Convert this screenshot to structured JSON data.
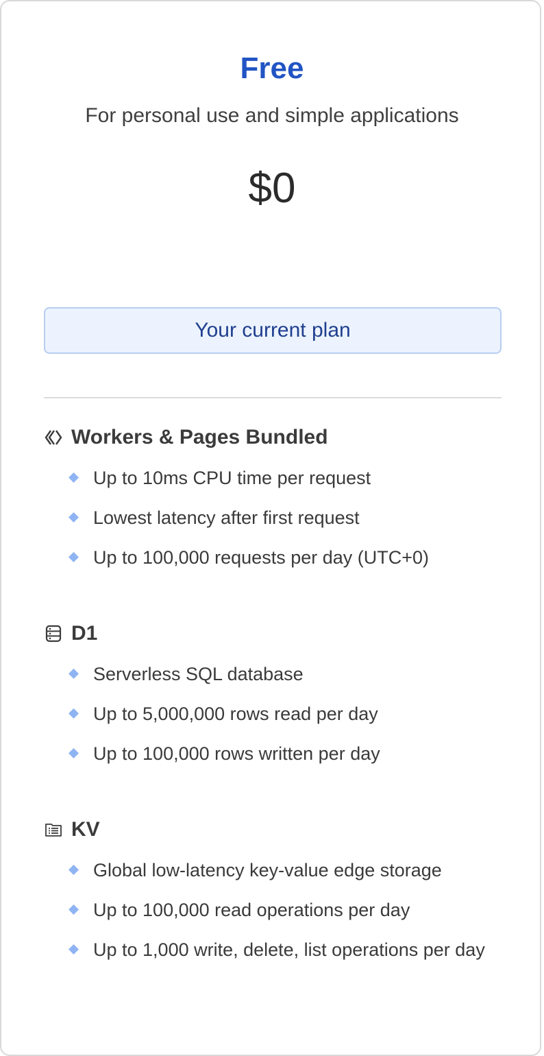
{
  "plan": {
    "name": "Free",
    "description": "For personal use and simple applications",
    "price": "$0",
    "button_label": "Your current plan"
  },
  "colors": {
    "accent": "#2154c4",
    "button_bg": "#ecf3fe",
    "button_border": "#b8cdf1",
    "bullet": "#8fb4f3"
  },
  "sections": [
    {
      "title": "Workers & Pages Bundled",
      "icon": "workers-icon",
      "features": [
        "Up to 10ms CPU time per request",
        "Lowest latency after first request",
        "Up to 100,000 requests per day (UTC+0)"
      ]
    },
    {
      "title": "D1",
      "icon": "database-icon",
      "features": [
        "Serverless SQL database",
        "Up to 5,000,000 rows read per day",
        "Up to 100,000 rows written per day"
      ]
    },
    {
      "title": "KV",
      "icon": "kv-storage-icon",
      "features": [
        "Global low-latency key-value edge storage",
        "Up to 100,000 read operations per day",
        "Up to 1,000 write, delete, list operations per day"
      ]
    }
  ]
}
